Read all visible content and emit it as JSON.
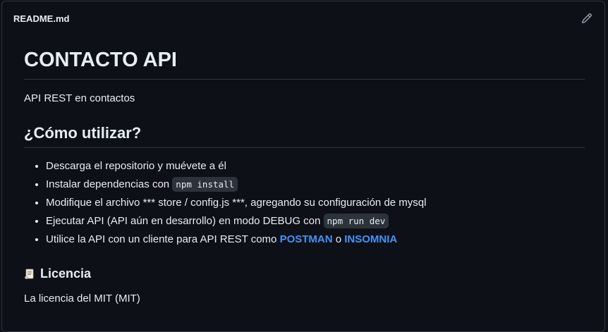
{
  "readme": {
    "filename": "README.md",
    "edit_icon": "pencil-icon"
  },
  "content": {
    "title": "CONTACTO API",
    "description": "API REST en contactos",
    "usage_heading": "¿Cómo utilizar?",
    "steps": [
      {
        "text": "Descarga el repositorio y muévete a él"
      },
      {
        "text": "Instalar dependencias con ",
        "code": "npm install"
      },
      {
        "text": "Modifique el archivo *** store / config.js ***, agregando su configuración de mysql"
      },
      {
        "text": "Ejecutar API (API aún en desarrollo) en modo DEBUG con ",
        "code": "npm run dev"
      },
      {
        "text": "Utilice la API con un cliente para API REST como ",
        "link1": "POSTMAN",
        "sep": " o ",
        "link2": "INSOMNIA"
      }
    ],
    "license_heading": "Licencia",
    "license_icon": "scroll-icon",
    "license_text": "La licencia del MIT (MIT)"
  },
  "colors": {
    "background": "#0d1117",
    "border": "#30363d",
    "text": "#e6edf3",
    "link": "#4493f8",
    "code_bg": "#2d333b"
  }
}
